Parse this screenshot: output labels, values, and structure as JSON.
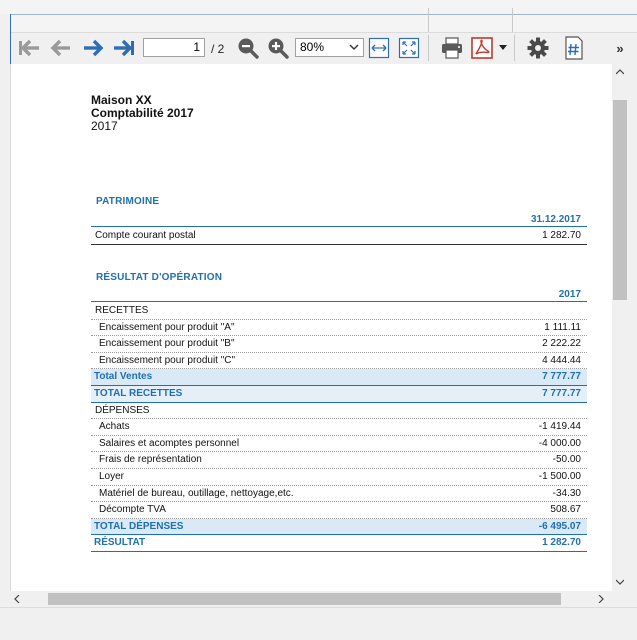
{
  "toolbar": {
    "page_current": "1",
    "page_total": "/ 2",
    "zoom": "80%",
    "more": "»"
  },
  "document": {
    "header": {
      "line1": "Maison XX",
      "line2": "Comptabilité 2017",
      "line3": "2017"
    },
    "patrimoine": {
      "title": "PATRIMOINE",
      "column": "31.12.2017",
      "rows": [
        {
          "label": "Compte courant postal",
          "value": "1 282.70"
        }
      ]
    },
    "resultat": {
      "title": "RÉSULTAT D'OPÉRATION",
      "column": "2017",
      "recettes_label": "RECETTES",
      "recettes": [
        {
          "label": "Encaissement pour produit \"A\"",
          "value": "1 111.11"
        },
        {
          "label": "Encaissement pour produit \"B\"",
          "value": "2 222.22"
        },
        {
          "label": "Encaissement pour produit \"C\"",
          "value": "4 444.44"
        }
      ],
      "total_ventes": {
        "label": "Total Ventes",
        "value": "7 777.77"
      },
      "total_recettes": {
        "label": "TOTAL RECETTES",
        "value": "7 777.77"
      },
      "depenses_label": "DÉPENSES",
      "depenses": [
        {
          "label": "Achats",
          "value": "-1 419.44"
        },
        {
          "label": "Salaires et acomptes personnel",
          "value": "-4 000.00"
        },
        {
          "label": "Frais de représentation",
          "value": "-50.00"
        },
        {
          "label": "Loyer",
          "value": "-1 500.00"
        },
        {
          "label": "Matériel de bureau, outillage, nettoyage,etc.",
          "value": "-34.30"
        },
        {
          "label": "Décompte TVA",
          "value": "508.67"
        }
      ],
      "total_depenses": {
        "label": "TOTAL DÉPENSES",
        "value": "-6 495.07"
      },
      "resultat": {
        "label": "RÉSULTAT",
        "value": "1 282.70"
      }
    }
  },
  "colors": {
    "accent": "#1f6fb2",
    "total_fill": "#d9eaf6",
    "nav_blue": "#2e6db4",
    "nav_gray": "#9a9a9a",
    "pdf_red": "#c0392b"
  }
}
